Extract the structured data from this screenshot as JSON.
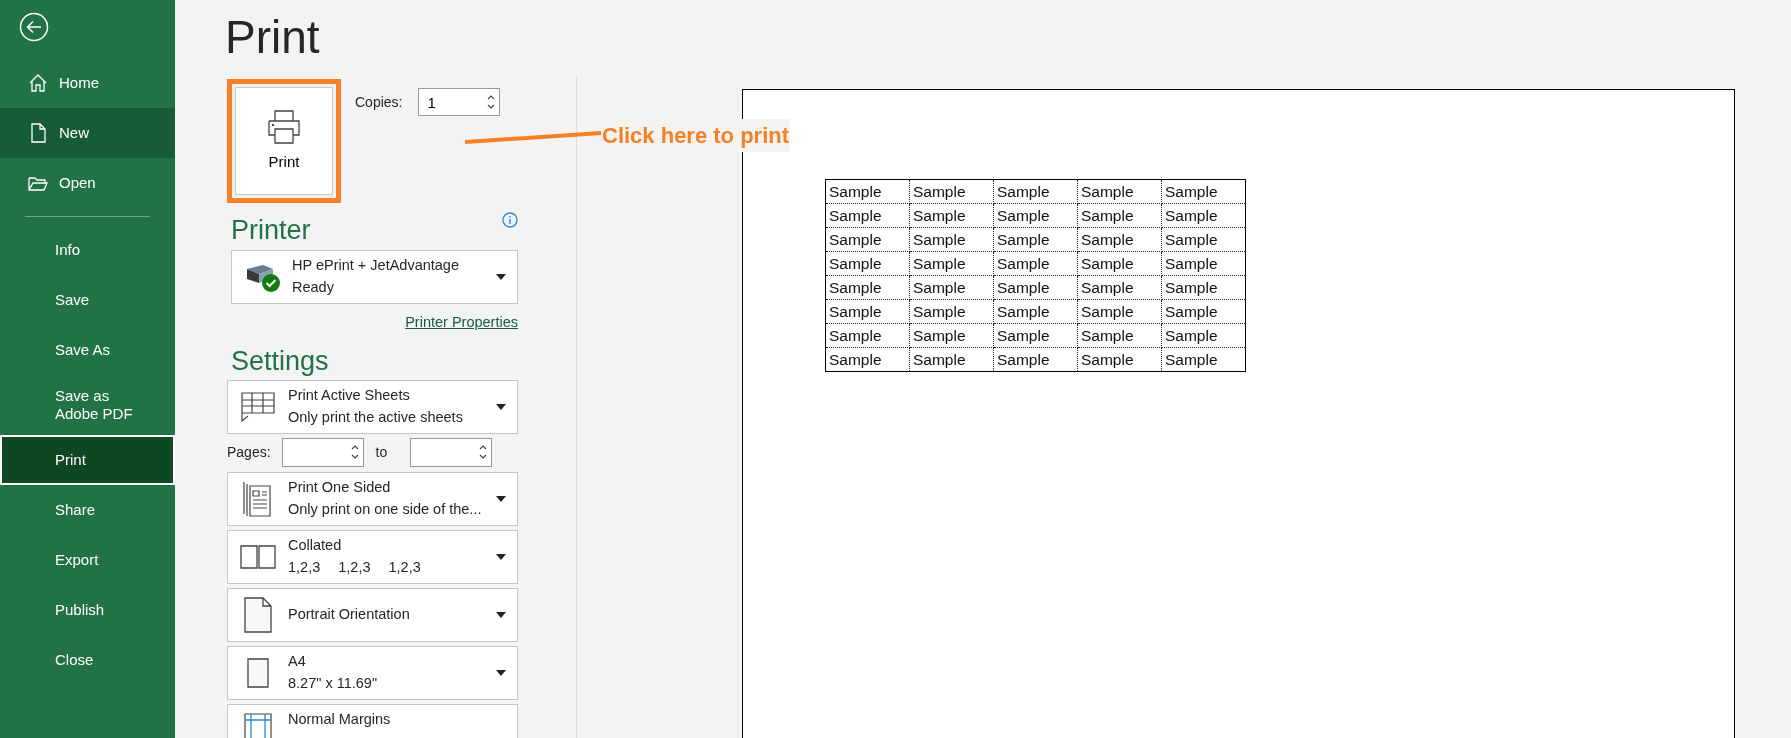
{
  "sidebar": {
    "top_items": [
      {
        "label": "Home",
        "hovered": false,
        "selected": false
      },
      {
        "label": "New",
        "hovered": true,
        "selected": false
      },
      {
        "label": "Open",
        "hovered": false,
        "selected": false
      }
    ],
    "items": [
      {
        "label": "Info",
        "hovered": false,
        "selected": false
      },
      {
        "label": "Save",
        "hovered": false,
        "selected": false
      },
      {
        "label": "Save As",
        "hovered": false,
        "selected": false
      },
      {
        "label": "Save as Adobe PDF",
        "hovered": false,
        "selected": false
      },
      {
        "label": "Print",
        "hovered": false,
        "selected": true
      },
      {
        "label": "Share",
        "hovered": false,
        "selected": false
      },
      {
        "label": "Export",
        "hovered": false,
        "selected": false
      },
      {
        "label": "Publish",
        "hovered": false,
        "selected": false
      },
      {
        "label": "Close",
        "hovered": false,
        "selected": false
      }
    ]
  },
  "title": "Print",
  "print_button": {
    "label": "Print"
  },
  "copies": {
    "label": "Copies:",
    "value": "1"
  },
  "annotation": {
    "text": "Click here to print"
  },
  "printer": {
    "heading": "Printer",
    "name": "HP ePrint + JetAdvantage",
    "status": "Ready",
    "link": "Printer Properties"
  },
  "settings": {
    "heading": "Settings",
    "pages": {
      "label": "Pages:",
      "to_label": "to"
    },
    "options": [
      {
        "kind": "sheets",
        "title": "Print Active Sheets",
        "subtitle": "Only print the active sheets"
      },
      {
        "kind": "sides",
        "title": "Print One Sided",
        "subtitle": "Only print on one side of the..."
      },
      {
        "kind": "collate",
        "title": "Collated",
        "subtitle_parts": [
          "1,2,3",
          "1,2,3",
          "1,2,3"
        ]
      },
      {
        "kind": "orientation",
        "title": "Portrait Orientation"
      },
      {
        "kind": "paper",
        "title": "A4",
        "subtitle": "8.27\" x 11.69\""
      },
      {
        "kind": "margins",
        "title": "Normal Margins"
      }
    ]
  },
  "preview": {
    "rows": [
      [
        "Sample",
        "Sample",
        "Sample",
        "Sample",
        "Sample"
      ],
      [
        "Sample",
        "Sample",
        "Sample",
        "Sample",
        "Sample"
      ],
      [
        "Sample",
        "Sample",
        "Sample",
        "Sample",
        "Sample"
      ],
      [
        "Sample",
        "Sample",
        "Sample",
        "Sample",
        "Sample"
      ],
      [
        "Sample",
        "Sample",
        "Sample",
        "Sample",
        "Sample"
      ],
      [
        "Sample",
        "Sample",
        "Sample",
        "Sample",
        "Sample"
      ],
      [
        "Sample",
        "Sample",
        "Sample",
        "Sample",
        "Sample"
      ],
      [
        "Sample",
        "Sample",
        "Sample",
        "Sample",
        "Sample"
      ]
    ]
  }
}
